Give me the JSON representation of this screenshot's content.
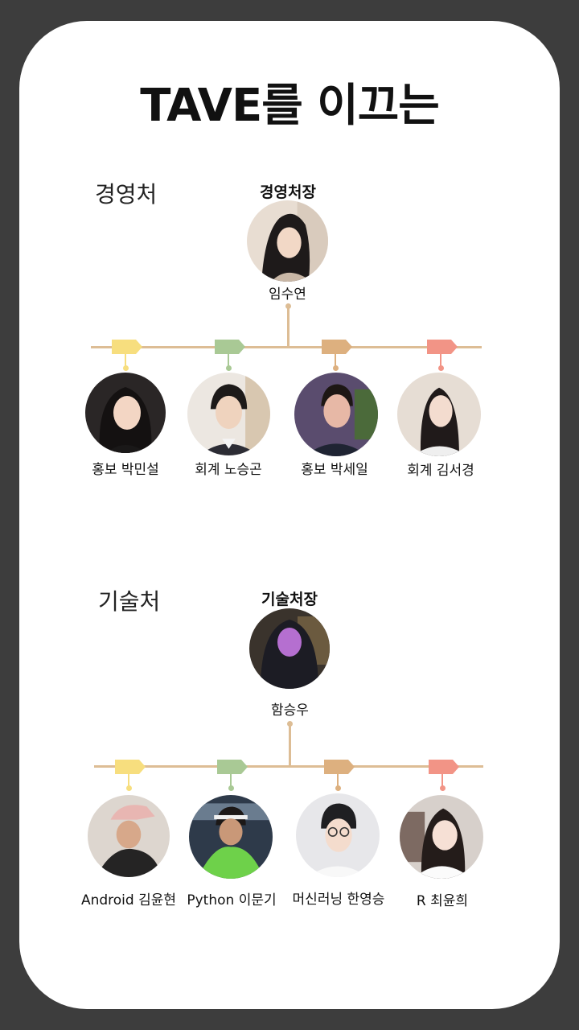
{
  "title": "TAVE를 이끄는",
  "colors": {
    "background": "#3d3d3d",
    "card": "#ffffff",
    "connector": "#ddbd95",
    "tag_yellow": "#f7de7e",
    "tag_green": "#a9c995",
    "tag_tan": "#ddb07f",
    "tag_pink": "#f29486"
  },
  "management": {
    "label": "경영처",
    "head": {
      "role": "경영처장",
      "name": "임수연"
    },
    "members": [
      {
        "label": "홍보 박민설",
        "tag_color": "#f7de7e"
      },
      {
        "label": "회계 노승곤",
        "tag_color": "#a9c995"
      },
      {
        "label": "홍보 박세일",
        "tag_color": "#ddb07f"
      },
      {
        "label": "회계 김서경",
        "tag_color": "#f29486"
      }
    ]
  },
  "tech": {
    "label": "기술처",
    "head": {
      "role": "기술처장",
      "name": "함승우"
    },
    "members": [
      {
        "label": "Android 김윤현",
        "tag_color": "#f7de7e"
      },
      {
        "label": "Python 이문기",
        "tag_color": "#a9c995"
      },
      {
        "label": "머신러닝 한영승",
        "tag_color": "#ddb07f"
      },
      {
        "label": "R 최윤희",
        "tag_color": "#f29486"
      }
    ]
  }
}
